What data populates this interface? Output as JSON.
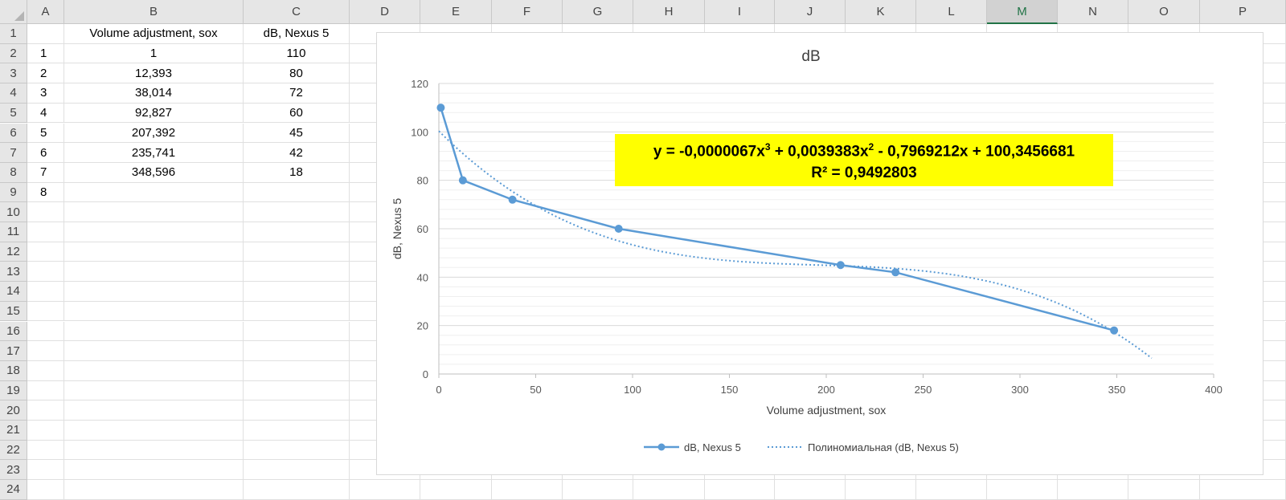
{
  "grid": {
    "columns": [
      "A",
      "B",
      "C",
      "D",
      "E",
      "F",
      "G",
      "H",
      "I",
      "J",
      "K",
      "L",
      "M",
      "N",
      "O",
      "P"
    ],
    "selected_column": "M",
    "rows": [
      "1",
      "2",
      "3",
      "4",
      "5",
      "6",
      "7",
      "8",
      "9",
      "10",
      "11",
      "12",
      "13",
      "14",
      "15",
      "16",
      "17",
      "18",
      "19",
      "20",
      "21",
      "22",
      "23",
      "24"
    ],
    "cells": [
      {
        "col": "B",
        "row": 1,
        "value": "Volume adjustment, sox"
      },
      {
        "col": "C",
        "row": 1,
        "value": "dB, Nexus 5"
      },
      {
        "col": "A",
        "row": 2,
        "value": "1"
      },
      {
        "col": "B",
        "row": 2,
        "value": "1"
      },
      {
        "col": "C",
        "row": 2,
        "value": "110"
      },
      {
        "col": "A",
        "row": 3,
        "value": "2"
      },
      {
        "col": "B",
        "row": 3,
        "value": "12,393"
      },
      {
        "col": "C",
        "row": 3,
        "value": "80"
      },
      {
        "col": "A",
        "row": 4,
        "value": "3"
      },
      {
        "col": "B",
        "row": 4,
        "value": "38,014"
      },
      {
        "col": "C",
        "row": 4,
        "value": "72"
      },
      {
        "col": "A",
        "row": 5,
        "value": "4"
      },
      {
        "col": "B",
        "row": 5,
        "value": "92,827"
      },
      {
        "col": "C",
        "row": 5,
        "value": "60"
      },
      {
        "col": "A",
        "row": 6,
        "value": "5"
      },
      {
        "col": "B",
        "row": 6,
        "value": "207,392"
      },
      {
        "col": "C",
        "row": 6,
        "value": "45"
      },
      {
        "col": "A",
        "row": 7,
        "value": "6"
      },
      {
        "col": "B",
        "row": 7,
        "value": "235,741"
      },
      {
        "col": "C",
        "row": 7,
        "value": "42"
      },
      {
        "col": "A",
        "row": 8,
        "value": "7"
      },
      {
        "col": "B",
        "row": 8,
        "value": "348,596"
      },
      {
        "col": "C",
        "row": 8,
        "value": "18"
      },
      {
        "col": "A",
        "row": 9,
        "value": "8"
      }
    ]
  },
  "chart_data": {
    "type": "scatter",
    "title": "dB",
    "xlabel": "Volume adjustment, sox",
    "ylabel": "dB, Nexus 5",
    "xlim": [
      0,
      400
    ],
    "ylim": [
      0,
      120
    ],
    "x_ticks": [
      "0",
      "50",
      "100",
      "150",
      "200",
      "250",
      "300",
      "350",
      "400"
    ],
    "y_ticks": [
      "0",
      "20",
      "40",
      "60",
      "80",
      "100",
      "120"
    ],
    "grid": true,
    "legend_position": "bottom",
    "series": [
      {
        "name": "dB, Nexus 5",
        "color": "#5b9bd5",
        "style": "solid-with-markers",
        "x": [
          1,
          12.393,
          38.014,
          92.827,
          207.392,
          235.741,
          348.596
        ],
        "y": [
          110,
          80,
          72,
          60,
          45,
          42,
          18
        ]
      }
    ],
    "trendline": {
      "name": "Полиномиальная (dB, Nexus 5)",
      "color": "#5b9bd5",
      "style": "dotted",
      "order": 3,
      "coefficients": [
        -6.7e-06,
        0.0039383,
        -0.7969212,
        100.3456681
      ],
      "x_range": [
        0,
        368
      ],
      "equation_parts": [
        "y = -0,0000067x",
        "3",
        " + 0,0039383x",
        "2",
        " - 0,7969212x + 100,3456681"
      ],
      "r_squared_label": "R² = 0,9492803",
      "label_background": "#ffff00"
    }
  }
}
